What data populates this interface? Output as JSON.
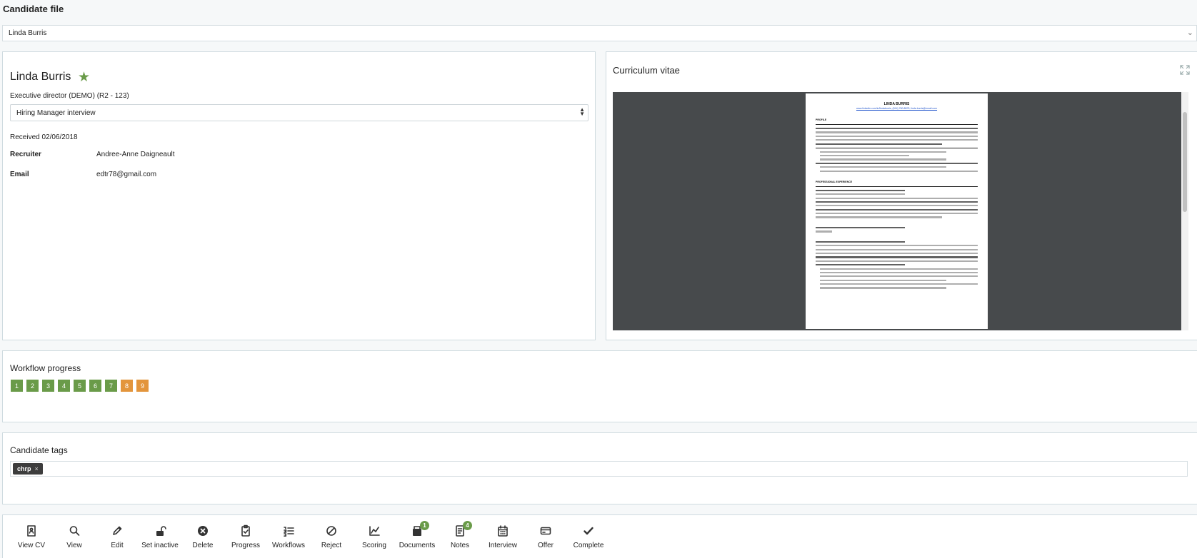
{
  "page": {
    "title": "Candidate file"
  },
  "candidate_selector": {
    "value": "Linda Burris"
  },
  "candidate": {
    "name": "Linda Burris",
    "job": "Executive director (DEMO) (R2 - 123)",
    "stage": "Hiring Manager interview",
    "received": "Received 02/06/2018",
    "recruiter_label": "Recruiter",
    "recruiter": "Andree-Anne Daigneault",
    "email_label": "Email",
    "email": "edtr78@gmail.com"
  },
  "cv": {
    "title": "Curriculum vitae",
    "doc_name": "LINDA BURRIS",
    "doc_contact": "www.linkedin.com/in/lindaburris, (514) 780-8875, linda.burris@email.com",
    "section_profile": "PROFILE",
    "section_experience": "PROFESSIONAL EXPERIENCE"
  },
  "workflow": {
    "title": "Workflow progress",
    "steps": [
      {
        "label": "1",
        "status": "done"
      },
      {
        "label": "2",
        "status": "done"
      },
      {
        "label": "3",
        "status": "done"
      },
      {
        "label": "4",
        "status": "done"
      },
      {
        "label": "5",
        "status": "done"
      },
      {
        "label": "6",
        "status": "done"
      },
      {
        "label": "7",
        "status": "done"
      },
      {
        "label": "8",
        "status": "pending"
      },
      {
        "label": "9",
        "status": "pending"
      }
    ],
    "colors": {
      "done": "#6a9b49",
      "pending": "#e3953c"
    }
  },
  "tags": {
    "title": "Candidate tags",
    "items": [
      {
        "label": "chrp",
        "remove": "×"
      }
    ]
  },
  "actions": [
    {
      "label": "View CV",
      "icon": "cv-icon"
    },
    {
      "label": "View",
      "icon": "search-icon"
    },
    {
      "label": "Edit",
      "icon": "pencil-icon"
    },
    {
      "label": "Set inactive",
      "icon": "unlock-icon"
    },
    {
      "label": "Delete",
      "icon": "close-circle-icon"
    },
    {
      "label": "Progress",
      "icon": "clipboard-check-icon"
    },
    {
      "label": "Workflows",
      "icon": "list-icon"
    },
    {
      "label": "Reject",
      "icon": "ban-icon"
    },
    {
      "label": "Scoring",
      "icon": "chart-icon"
    },
    {
      "label": "Documents",
      "icon": "documents-icon",
      "badge": "1"
    },
    {
      "label": "Notes",
      "icon": "notes-icon",
      "badge": "4"
    },
    {
      "label": "Interview",
      "icon": "calendar-icon"
    },
    {
      "label": "Offer",
      "icon": "card-icon"
    },
    {
      "label": "Complete",
      "icon": "check-icon"
    }
  ]
}
